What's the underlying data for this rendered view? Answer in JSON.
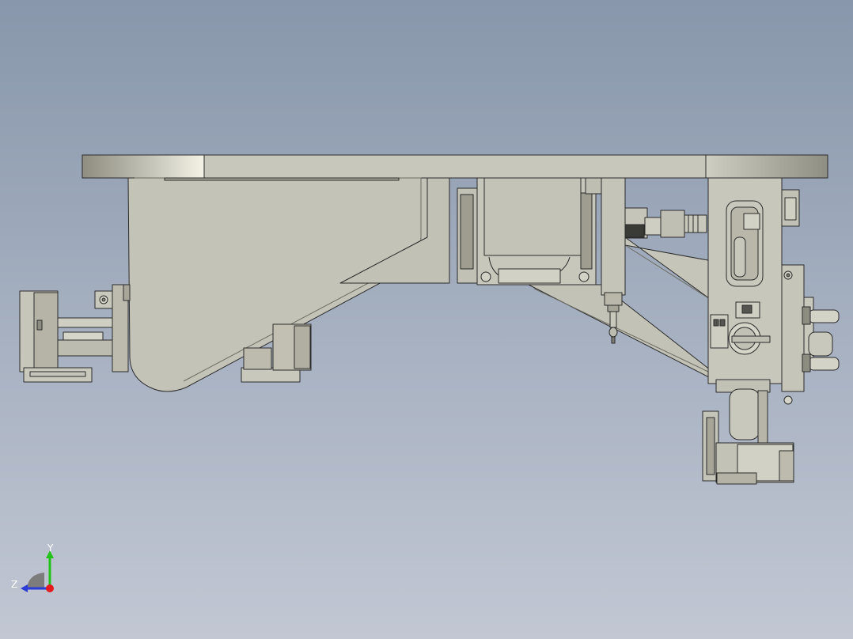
{
  "viewport": {
    "background_top": "#8897ab",
    "background_bottom": "#c2c7d3",
    "model_name": "cad-assembly-side-view",
    "colors": {
      "part_fill": "#c6c5bb",
      "part_fill_dark": "#a9a899",
      "part_fill_light": "#dcdbd0",
      "edge": "#2b2b2b"
    }
  },
  "triad": {
    "y_label": "Y",
    "z_label": "Z",
    "y_color": "#22c21a",
    "z_color": "#2a3bd8",
    "x_color": "#e3191f"
  }
}
